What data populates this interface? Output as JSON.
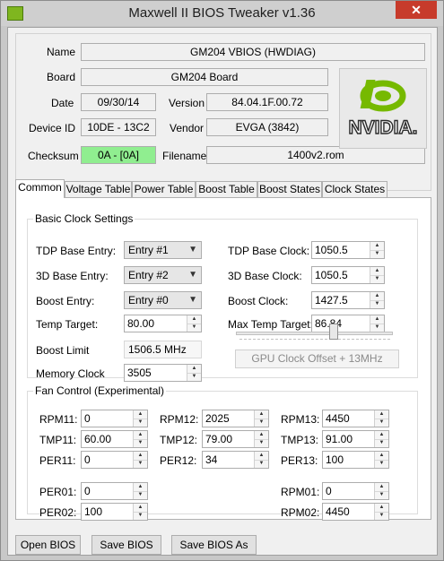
{
  "window": {
    "title": "Maxwell II BIOS Tweaker v1.36",
    "close_glyph": "✕"
  },
  "info": {
    "name_label": "Name",
    "name_value": "GM204 VBIOS (HWDIAG)",
    "board_label": "Board",
    "board_value": "GM204 Board",
    "date_label": "Date",
    "date_value": "09/30/14",
    "version_label": "Version",
    "version_value": "84.04.1F.00.72",
    "device_label": "Device ID",
    "device_value": "10DE - 13C2",
    "vendor_label": "Vendor",
    "vendor_value": "EVGA (3842)",
    "checksum_label": "Checksum",
    "checksum_value": "0A - [0A]",
    "filename_label": "Filename",
    "filename_value": "1400v2.rom",
    "logo_text": "NVIDIA.",
    "logo_color": "#76b900"
  },
  "tabs": [
    "Common",
    "Voltage Table",
    "Power Table",
    "Boost Table",
    "Boost States",
    "Clock States"
  ],
  "basic": {
    "title": "Basic Clock Settings",
    "tdp_base_entry_label": "TDP Base Entry:",
    "tdp_base_entry_value": "Entry #1",
    "base3d_entry_label": "3D Base Entry:",
    "base3d_entry_value": "Entry #2",
    "boost_entry_label": "Boost Entry:",
    "boost_entry_value": "Entry #0",
    "temp_target_label": "Temp Target:",
    "temp_target_value": "80.00",
    "boost_limit_label": "Boost Limit",
    "boost_limit_value": "1506.5 MHz",
    "memory_clock_label": "Memory Clock",
    "memory_clock_value": "3505",
    "tdp_base_clock_label": "TDP Base Clock:",
    "tdp_base_clock_value": "1050.5",
    "base3d_clock_label": "3D Base Clock:",
    "base3d_clock_value": "1050.5",
    "boost_clock_label": "Boost Clock:",
    "boost_clock_value": "1427.5",
    "max_temp_label": "Max Temp Target:",
    "max_temp_value": "86.84",
    "gpu_offset_level": 0.63,
    "gpu_offset_button": "GPU Clock Offset + 13MHz"
  },
  "fan": {
    "title": "Fan Control (Experimental)",
    "rpm11_label": "RPM11:",
    "rpm11_value": "0",
    "rpm12_label": "RPM12:",
    "rpm12_value": "2025",
    "rpm13_label": "RPM13:",
    "rpm13_value": "4450",
    "tmp11_label": "TMP11:",
    "tmp11_value": "60.00",
    "tmp12_label": "TMP12:",
    "tmp12_value": "79.00",
    "tmp13_label": "TMP13:",
    "tmp13_value": "91.00",
    "per11_label": "PER11:",
    "per11_value": "0",
    "per12_label": "PER12:",
    "per12_value": "34",
    "per13_label": "PER13:",
    "per13_value": "100",
    "per01_label": "PER01:",
    "per01_value": "0",
    "per02_label": "PER02:",
    "per02_value": "100",
    "rpm01_label": "RPM01:",
    "rpm01_value": "0",
    "rpm02_label": "RPM02:",
    "rpm02_value": "4450"
  },
  "buttons": {
    "open": "Open BIOS",
    "save": "Save BIOS",
    "save_as": "Save BIOS As"
  }
}
